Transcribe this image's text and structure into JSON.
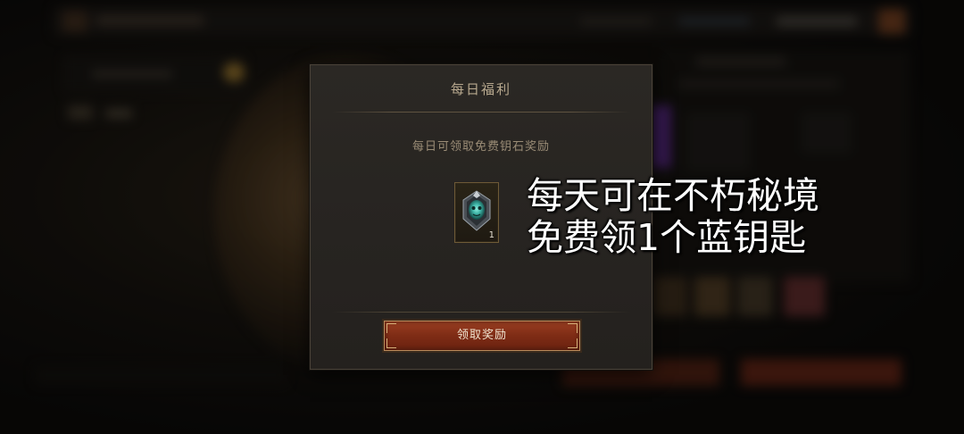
{
  "dialog": {
    "title": "每日福利",
    "description": "每日可领取免费钥石奖励",
    "reward": {
      "icon": "blue-key-icon",
      "count": "1"
    },
    "claim_button_label": "领取奖励"
  },
  "caption": {
    "line1": "每天可在不朽秘境",
    "line2": "免费领1个蓝钥匙"
  },
  "colors": {
    "dialog_bg": "#2b2824",
    "title_text": "#b7a88e",
    "button_bg": "#8a3419",
    "button_border": "#b98a5a",
    "reward_border": "#6e5a36",
    "gem_teal": "#3fb6a8"
  }
}
